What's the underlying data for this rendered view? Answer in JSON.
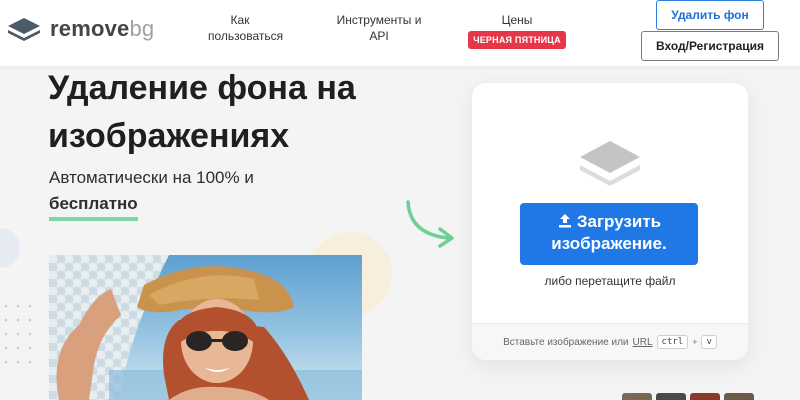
{
  "brand": {
    "name_main": "remove",
    "name_suffix": "bg"
  },
  "nav": {
    "how": "Как пользоваться",
    "tools": "Инструменты и API",
    "prices": "Цены",
    "promo": "ЧЕРНАЯ ПЯТНИЦА"
  },
  "header_buttons": {
    "remove_bg": "Удалить фон",
    "login": "Вход/Регистрация"
  },
  "hero": {
    "title": "Удаление фона на изображениях",
    "subtitle": "Автоматически на 100% и",
    "free": "бесплатно"
  },
  "upload": {
    "button": "Загрузить изображение.",
    "drop_hint": "либо перетащите файл",
    "paste_hint": "Вставьте изображение или",
    "url_link": "URL",
    "key_ctrl": "ctrl",
    "key_plus": "+",
    "key_v": "v"
  },
  "colors": {
    "accent": "#1f78e6",
    "promo": "#e6374a",
    "underline": "#7fd5a8",
    "arrow": "#6fcf97"
  },
  "icons": {
    "logo": "layers-logo-icon",
    "upload": "upload-arrow-icon",
    "card": "layers-icon",
    "arrow": "curved-arrow-icon"
  }
}
